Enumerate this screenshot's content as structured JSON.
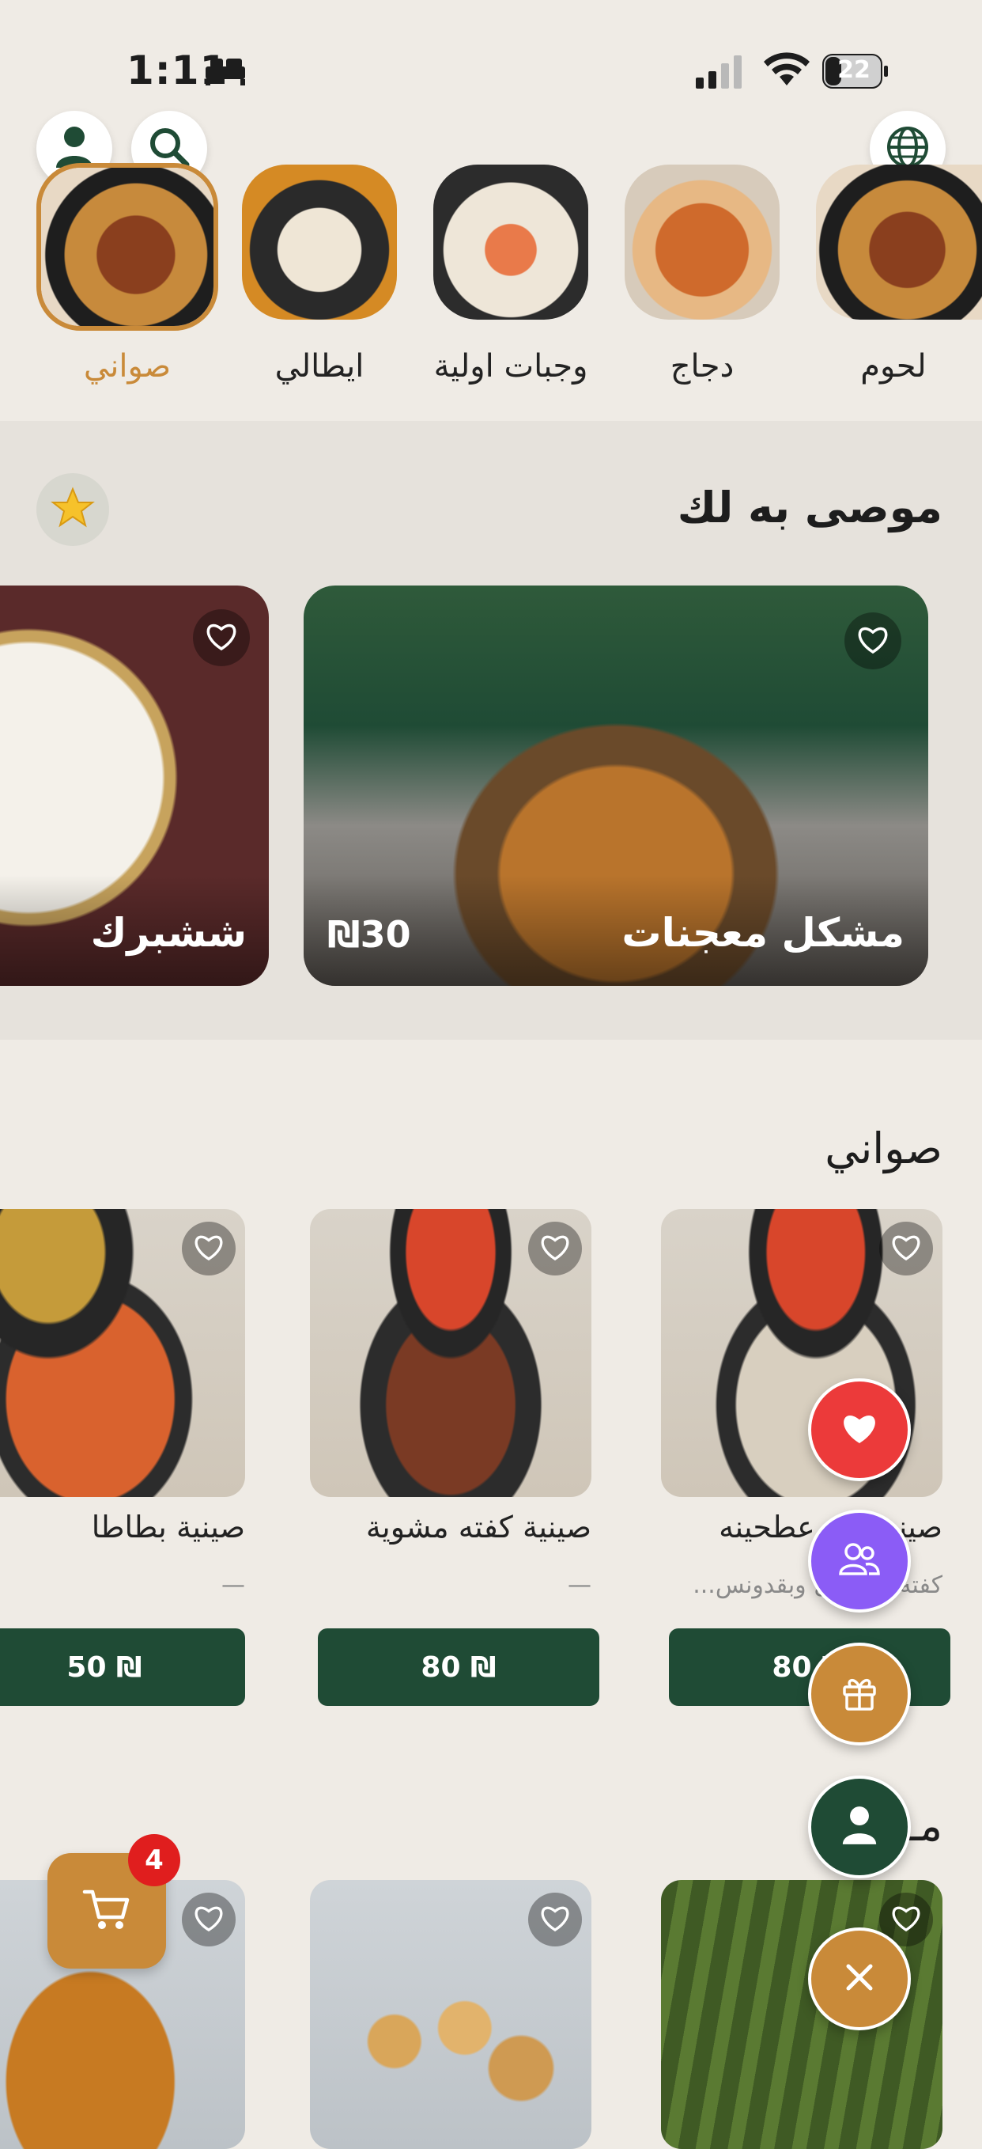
{
  "status_bar": {
    "time": "1:11",
    "battery": "22"
  },
  "categories": [
    {
      "label": "لحوم"
    },
    {
      "label": "دجاج"
    },
    {
      "label": "وجبات اولية"
    },
    {
      "label": "ايطالي"
    },
    {
      "label": "صواني",
      "active": true
    }
  ],
  "recommended": {
    "title": "موصى به لك",
    "items": [
      {
        "name": "مشكل معجنات",
        "price": "₪30"
      },
      {
        "name": "ششبرك"
      }
    ]
  },
  "trays": {
    "title": "صواني",
    "items": [
      {
        "name": "صينية فته عطحينه",
        "desc": "كفته مع بصل وبقدونس...",
        "price": "80 ₪"
      },
      {
        "name": "صينية كفته مشوية",
        "desc": "—",
        "price": "80 ₪"
      },
      {
        "name": "صينية بطاطا",
        "desc": "—",
        "price": "50 ₪"
      }
    ]
  },
  "next_section": {
    "title": "مـ"
  },
  "cart": {
    "count": "4"
  },
  "colors": {
    "brand_green": "#1f4b35",
    "accent_orange": "#c98a39",
    "fab_red": "#ec3a3a",
    "fab_purple": "#8b5cf6"
  }
}
